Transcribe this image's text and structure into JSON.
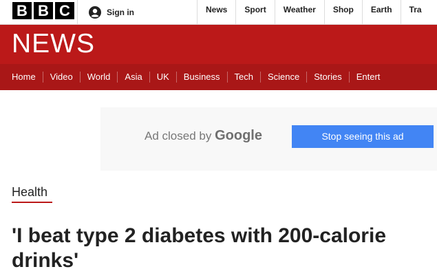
{
  "brand": {
    "letters": [
      "B",
      "B",
      "C"
    ]
  },
  "account": {
    "sign_in_label": "Sign in"
  },
  "top_nav": [
    "News",
    "Sport",
    "Weather",
    "Shop",
    "Earth",
    "Tra"
  ],
  "banner": {
    "title": "NEWS",
    "color": "#bb1919"
  },
  "section_nav": [
    "Home",
    "Video",
    "World",
    "Asia",
    "UK",
    "Business",
    "Tech",
    "Science",
    "Stories",
    "Entert"
  ],
  "ad": {
    "closed_by_text": "Ad closed by",
    "provider": "Google",
    "stop_button_label": "Stop seeing this ad",
    "button_color": "#4285f4"
  },
  "article": {
    "section": "Health",
    "headline": "'I beat type 2 diabetes with 200-calorie drinks'"
  }
}
